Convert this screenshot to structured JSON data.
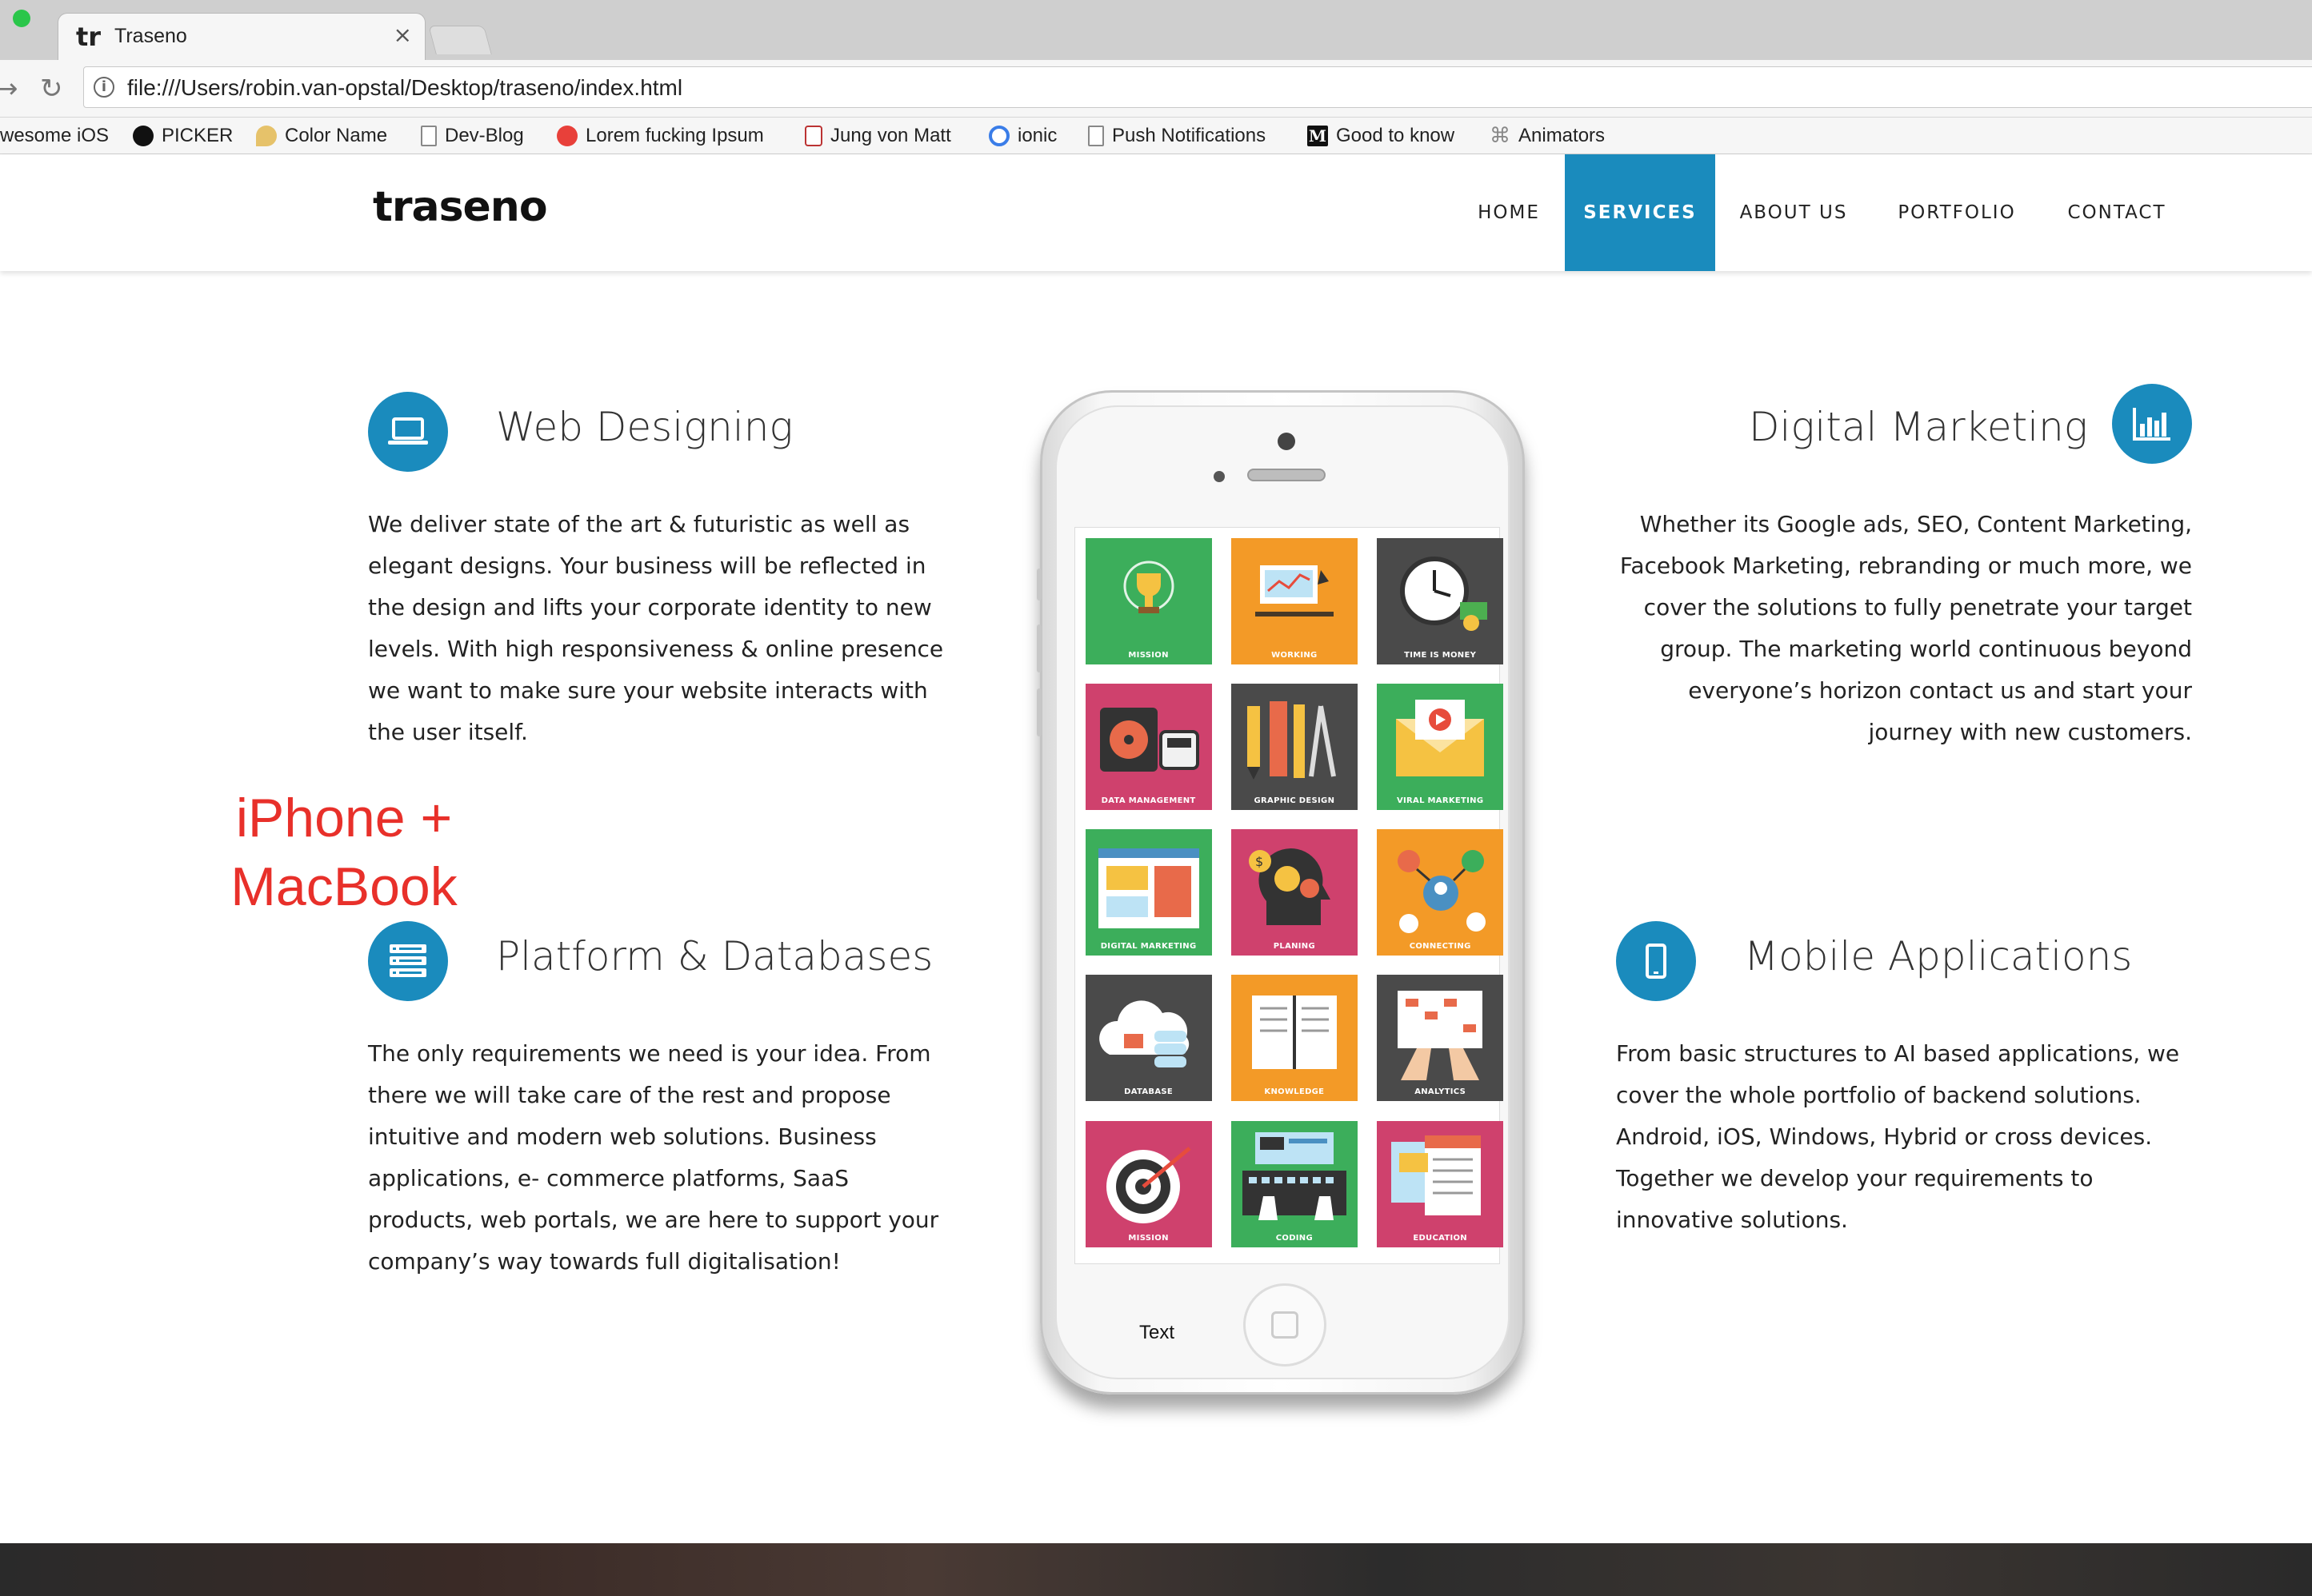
{
  "browser": {
    "tab_title": "Traseno",
    "tab_favicon": "tr",
    "close": "×",
    "url": "file:///Users/robin.van-opstal/Desktop/traseno/index.html",
    "bookmarks": [
      {
        "label": "wesome iOS",
        "icon": "none"
      },
      {
        "label": "PICKER",
        "icon": "github-icon"
      },
      {
        "label": "Color Name",
        "icon": "pin-icon"
      },
      {
        "label": "Dev-Blog",
        "icon": "page-icon"
      },
      {
        "label": "Lorem fucking Ipsum",
        "icon": "red-dot-icon"
      },
      {
        "label": "Jung von Matt",
        "icon": "jvm-icon"
      },
      {
        "label": "ionic",
        "icon": "ionic-icon"
      },
      {
        "label": "Push Notifications",
        "icon": "page-icon"
      },
      {
        "label": "Good to know",
        "icon": "medium-icon"
      },
      {
        "label": "Animators",
        "icon": "command-icon"
      }
    ]
  },
  "site": {
    "logo": "traseno",
    "nav": [
      "HOME",
      "SERVICES",
      "ABOUT US",
      "PORTFOLIO",
      "CONTACT"
    ],
    "active_nav": "SERVICES",
    "accent_color": "#1a8bbd"
  },
  "services": {
    "web": {
      "title": "Web Designing",
      "text": "We deliver state of the art & futuristic as well as elegant designs. Your business will be reflected in the design and lifts your corporate identity to new levels. With high responsiveness & online presence we want to make sure your website interacts with the user itself.",
      "icon": "laptop-icon"
    },
    "platform": {
      "title": "Platform & Databases",
      "text": "The only requirements we need is your idea. From there we will take care of the rest and propose intuitive and modern web solutions. Business applications, e- commerce platforms, SaaS products, web portals, we are here to support your company’s way towards full digitalisation!",
      "icon": "server-icon"
    },
    "marketing": {
      "title": "Digital Marketing",
      "text": "Whether its Google ads, SEO, Content Marketing, Facebook Marketing, rebranding or much more, we cover the solutions to fully penetrate your target group. The marketing world continuous beyond everyone’s horizon contact us and start your journey with new customers.",
      "icon": "bar-chart-icon"
    },
    "mobile": {
      "title": "Mobile Applications",
      "text": "From basic structures to AI based applications, we cover the whole portfolio of backend solutions. Android, iOS, Windows, Hybrid or cross devices. Together we develop your requirements to innovative solutions.",
      "icon": "mobile-icon"
    }
  },
  "annotation": {
    "line1": "iPhone +",
    "line2": "MacBook"
  },
  "phone_screen": {
    "overlay_text": "Text",
    "tiles": [
      {
        "label": "MISSION",
        "color": "#3cae5b",
        "icon": "trophy-icon"
      },
      {
        "label": "WORKING",
        "color": "#f39a27",
        "icon": "desk-icon"
      },
      {
        "label": "TIME IS MONEY",
        "color": "#4a4a4a",
        "icon": "clock-icon"
      },
      {
        "label": "DATA MANAGEMENT",
        "color": "#cf416d",
        "icon": "disk-icon"
      },
      {
        "label": "GRAPHIC DESIGN",
        "color": "#4a4a4a",
        "icon": "pencil-icon"
      },
      {
        "label": "VIRAL MARKETING",
        "color": "#3cae5b",
        "icon": "envelope-icon"
      },
      {
        "label": "DIGITAL MARKETING",
        "color": "#3cae5b",
        "icon": "browser-icon"
      },
      {
        "label": "PLANING",
        "color": "#cf416d",
        "icon": "head-gears-icon"
      },
      {
        "label": "CONNECTING",
        "color": "#f39a27",
        "icon": "network-icon"
      },
      {
        "label": "DATABASE",
        "color": "#4a4a4a",
        "icon": "cloud-icon"
      },
      {
        "label": "KNOWLEDGE",
        "color": "#f39a27",
        "icon": "book-icon"
      },
      {
        "label": "ANALYTICS",
        "color": "#4a4a4a",
        "icon": "chart-hands-icon"
      },
      {
        "label": "MISSION",
        "color": "#cf416d",
        "icon": "target-icon"
      },
      {
        "label": "CODING",
        "color": "#3cae5b",
        "icon": "keyboard-icon"
      },
      {
        "label": "EDUCATION",
        "color": "#cf416d",
        "icon": "documents-icon"
      }
    ]
  }
}
